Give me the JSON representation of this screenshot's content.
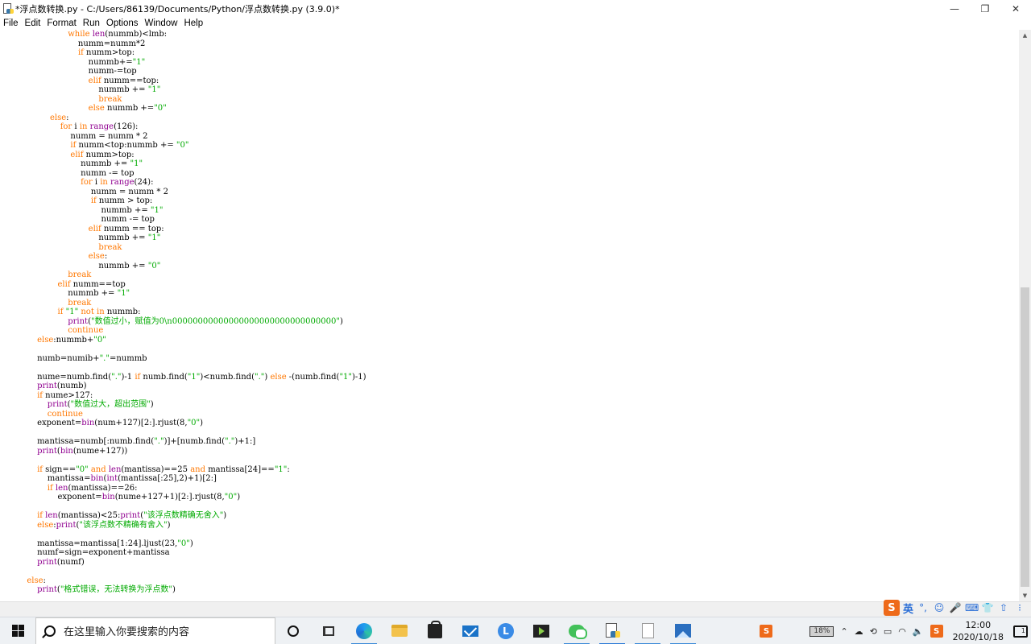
{
  "window": {
    "title": "*浮点数转换.py - C:/Users/86139/Documents/Python/浮点数转换.py (3.9.0)*",
    "minimize_glyph": "—",
    "maximize_glyph": "❐",
    "close_glyph": "✕"
  },
  "menu": {
    "items": [
      "File",
      "Edit",
      "Format",
      "Run",
      "Options",
      "Window",
      "Help"
    ]
  },
  "editor": {
    "lines": [
      [
        {
          "t": "                  "
        },
        {
          "t": "while",
          "c": "kw"
        },
        {
          "t": " "
        },
        {
          "t": "len",
          "c": "bi"
        },
        {
          "t": "(nummb)<lmb:"
        }
      ],
      [
        {
          "t": "                      numm=numm*2"
        }
      ],
      [
        {
          "t": "                      "
        },
        {
          "t": "if",
          "c": "kw"
        },
        {
          "t": " numm>top:"
        }
      ],
      [
        {
          "t": "                          nummb+="
        },
        {
          "t": "\"1\"",
          "c": "st"
        }
      ],
      [
        {
          "t": "                          numm-=top"
        }
      ],
      [
        {
          "t": "                          "
        },
        {
          "t": "elif",
          "c": "kw"
        },
        {
          "t": " numm==top:"
        }
      ],
      [
        {
          "t": "                              nummb += "
        },
        {
          "t": "\"1\"",
          "c": "st"
        }
      ],
      [
        {
          "t": "                              "
        },
        {
          "t": "break",
          "c": "kw"
        }
      ],
      [
        {
          "t": "                          "
        },
        {
          "t": "else",
          "c": "kw"
        },
        {
          "t": " nummb +="
        },
        {
          "t": "\"0\"",
          "c": "st"
        }
      ],
      [
        {
          "t": "           "
        },
        {
          "t": "else",
          "c": "kw"
        },
        {
          "t": ":"
        }
      ],
      [
        {
          "t": "               "
        },
        {
          "t": "for",
          "c": "kw"
        },
        {
          "t": " i "
        },
        {
          "t": "in",
          "c": "kw"
        },
        {
          "t": " "
        },
        {
          "t": "range",
          "c": "bi"
        },
        {
          "t": "(126):"
        }
      ],
      [
        {
          "t": "                   numm = numm * 2"
        }
      ],
      [
        {
          "t": "                   "
        },
        {
          "t": "if",
          "c": "kw"
        },
        {
          "t": " numm<top:nummb += "
        },
        {
          "t": "\"0\"",
          "c": "st"
        }
      ],
      [
        {
          "t": "                   "
        },
        {
          "t": "elif",
          "c": "kw"
        },
        {
          "t": " numm>top:"
        }
      ],
      [
        {
          "t": "                       nummb += "
        },
        {
          "t": "\"1\"",
          "c": "st"
        }
      ],
      [
        {
          "t": "                       numm -= top"
        }
      ],
      [
        {
          "t": "                       "
        },
        {
          "t": "for",
          "c": "kw"
        },
        {
          "t": " i "
        },
        {
          "t": "in",
          "c": "kw"
        },
        {
          "t": " "
        },
        {
          "t": "range",
          "c": "bi"
        },
        {
          "t": "(24):"
        }
      ],
      [
        {
          "t": "                           numm = numm * 2"
        }
      ],
      [
        {
          "t": "                           "
        },
        {
          "t": "if",
          "c": "kw"
        },
        {
          "t": " numm > top:"
        }
      ],
      [
        {
          "t": "                               nummb += "
        },
        {
          "t": "\"1\"",
          "c": "st"
        }
      ],
      [
        {
          "t": "                               numm -= top"
        }
      ],
      [
        {
          "t": "                          "
        },
        {
          "t": "elif",
          "c": "kw"
        },
        {
          "t": " numm == top:"
        }
      ],
      [
        {
          "t": "                              nummb += "
        },
        {
          "t": "\"1\"",
          "c": "st"
        }
      ],
      [
        {
          "t": "                              "
        },
        {
          "t": "break",
          "c": "kw"
        }
      ],
      [
        {
          "t": "                          "
        },
        {
          "t": "else",
          "c": "kw"
        },
        {
          "t": ":"
        }
      ],
      [
        {
          "t": "                              nummb += "
        },
        {
          "t": "\"0\"",
          "c": "st"
        }
      ],
      [
        {
          "t": "                  "
        },
        {
          "t": "break",
          "c": "kw"
        }
      ],
      [
        {
          "t": "              "
        },
        {
          "t": "elif",
          "c": "kw"
        },
        {
          "t": " numm==top"
        }
      ],
      [
        {
          "t": "                  nummb += "
        },
        {
          "t": "\"1\"",
          "c": "st"
        }
      ],
      [
        {
          "t": "                  "
        },
        {
          "t": "break",
          "c": "kw"
        }
      ],
      [
        {
          "t": "              "
        },
        {
          "t": "if",
          "c": "kw"
        },
        {
          "t": " "
        },
        {
          "t": "\"1\"",
          "c": "st"
        },
        {
          "t": " "
        },
        {
          "t": "not in",
          "c": "kw"
        },
        {
          "t": " nummb:"
        }
      ],
      [
        {
          "t": "                  "
        },
        {
          "t": "print",
          "c": "bi"
        },
        {
          "t": "("
        },
        {
          "t": "\"数值过小，赋值为0\\n00000000000000000000000000000000\"",
          "c": "st"
        },
        {
          "t": ")"
        }
      ],
      [
        {
          "t": "                  "
        },
        {
          "t": "continue",
          "c": "kw"
        }
      ],
      [
        {
          "t": "      "
        },
        {
          "t": "else",
          "c": "kw"
        },
        {
          "t": ":nummb+"
        },
        {
          "t": "\"0\"",
          "c": "st"
        }
      ],
      [
        {
          "t": ""
        }
      ],
      [
        {
          "t": "      numb=numib+"
        },
        {
          "t": "\".\"",
          "c": "st"
        },
        {
          "t": "=nummb"
        }
      ],
      [
        {
          "t": ""
        }
      ],
      [
        {
          "t": "      nume=numb.find("
        },
        {
          "t": "\".\"",
          "c": "st"
        },
        {
          "t": ")-1 "
        },
        {
          "t": "if",
          "c": "kw"
        },
        {
          "t": " numb.find("
        },
        {
          "t": "\"1\"",
          "c": "st"
        },
        {
          "t": ")<numb.find("
        },
        {
          "t": "\".\"",
          "c": "st"
        },
        {
          "t": ") "
        },
        {
          "t": "else",
          "c": "kw"
        },
        {
          "t": " -(numb.find("
        },
        {
          "t": "\"1\"",
          "c": "st"
        },
        {
          "t": ")-1)"
        }
      ],
      [
        {
          "t": "      "
        },
        {
          "t": "print",
          "c": "bi"
        },
        {
          "t": "(numb)"
        }
      ],
      [
        {
          "t": "      "
        },
        {
          "t": "if",
          "c": "kw"
        },
        {
          "t": " nume>127:"
        }
      ],
      [
        {
          "t": "          "
        },
        {
          "t": "print",
          "c": "bi"
        },
        {
          "t": "("
        },
        {
          "t": "\"数值过大，超出范围\"",
          "c": "st"
        },
        {
          "t": ")"
        }
      ],
      [
        {
          "t": "          "
        },
        {
          "t": "continue",
          "c": "kw"
        }
      ],
      [
        {
          "t": "      exponent="
        },
        {
          "t": "bin",
          "c": "bi"
        },
        {
          "t": "(num+127)[2:].rjust(8,"
        },
        {
          "t": "\"0\"",
          "c": "st"
        },
        {
          "t": ")"
        }
      ],
      [
        {
          "t": ""
        }
      ],
      [
        {
          "t": "      mantissa=numb[:numb.find("
        },
        {
          "t": "\".\"",
          "c": "st"
        },
        {
          "t": ")]+[numb.find("
        },
        {
          "t": "\".\"",
          "c": "st"
        },
        {
          "t": ")+1:]"
        }
      ],
      [
        {
          "t": "      "
        },
        {
          "t": "print",
          "c": "bi"
        },
        {
          "t": "("
        },
        {
          "t": "bin",
          "c": "bi"
        },
        {
          "t": "(nume+127))"
        }
      ],
      [
        {
          "t": ""
        }
      ],
      [
        {
          "t": "      "
        },
        {
          "t": "if",
          "c": "kw"
        },
        {
          "t": " sign=="
        },
        {
          "t": "\"0\"",
          "c": "st"
        },
        {
          "t": " "
        },
        {
          "t": "and",
          "c": "kw"
        },
        {
          "t": " "
        },
        {
          "t": "len",
          "c": "bi"
        },
        {
          "t": "(mantissa)==25 "
        },
        {
          "t": "and",
          "c": "kw"
        },
        {
          "t": " mantissa[24]=="
        },
        {
          "t": "\"1\"",
          "c": "st"
        },
        {
          "t": ":"
        }
      ],
      [
        {
          "t": "          mantissa="
        },
        {
          "t": "bin",
          "c": "bi"
        },
        {
          "t": "("
        },
        {
          "t": "int",
          "c": "bi"
        },
        {
          "t": "(mantissa[:25],2)+1)[2:]"
        }
      ],
      [
        {
          "t": "          "
        },
        {
          "t": "if",
          "c": "kw"
        },
        {
          "t": " "
        },
        {
          "t": "len",
          "c": "bi"
        },
        {
          "t": "(mantissa)==26:"
        }
      ],
      [
        {
          "t": "              exponent="
        },
        {
          "t": "bin",
          "c": "bi"
        },
        {
          "t": "(nume+127+1)[2:].rjust(8,"
        },
        {
          "t": "\"0\"",
          "c": "st"
        },
        {
          "t": ")"
        }
      ],
      [
        {
          "t": ""
        }
      ],
      [
        {
          "t": "      "
        },
        {
          "t": "if",
          "c": "kw"
        },
        {
          "t": " "
        },
        {
          "t": "len",
          "c": "bi"
        },
        {
          "t": "(mantissa)<25:"
        },
        {
          "t": "print",
          "c": "bi"
        },
        {
          "t": "("
        },
        {
          "t": "\"该浮点数精确无舍入\"",
          "c": "st"
        },
        {
          "t": ")"
        }
      ],
      [
        {
          "t": "      "
        },
        {
          "t": "else",
          "c": "kw"
        },
        {
          "t": ":"
        },
        {
          "t": "print",
          "c": "bi"
        },
        {
          "t": "("
        },
        {
          "t": "\"该浮点数不精确有舍入\"",
          "c": "st"
        },
        {
          "t": ")"
        }
      ],
      [
        {
          "t": ""
        }
      ],
      [
        {
          "t": "      mantissa=mantissa[1:24].ljust(23,"
        },
        {
          "t": "\"0\"",
          "c": "st"
        },
        {
          "t": ")"
        }
      ],
      [
        {
          "t": "      numf=sign=exponent+mantissa"
        }
      ],
      [
        {
          "t": "      "
        },
        {
          "t": "print",
          "c": "bi"
        },
        {
          "t": "(numf)"
        }
      ],
      [
        {
          "t": ""
        }
      ],
      [
        {
          "t": "  "
        },
        {
          "t": "else",
          "c": "kw"
        },
        {
          "t": ":"
        }
      ],
      [
        {
          "t": "      "
        },
        {
          "t": "print",
          "c": "bi"
        },
        {
          "t": "("
        },
        {
          "t": "\"格式错误，无法转换为浮点数\"",
          "c": "st"
        },
        {
          "t": ")"
        }
      ]
    ]
  },
  "ime": {
    "brand": "S",
    "lang": "英",
    "punct": "°,",
    "items": [
      "☺",
      "🎤",
      "⌨",
      "👕",
      "⇧",
      "⁝"
    ]
  },
  "taskbar": {
    "search_placeholder": "在这里输入你要搜索的内容",
    "l_app_letter": "L",
    "battery": "18%",
    "time": "12:00",
    "date": "2020/10/18",
    "notification_count": "1",
    "tray_brand": "S"
  },
  "colors": {
    "keyword": "#ff7700",
    "builtin": "#900090",
    "string": "#00aa00",
    "taskbar_bg": "#eef1f4"
  }
}
